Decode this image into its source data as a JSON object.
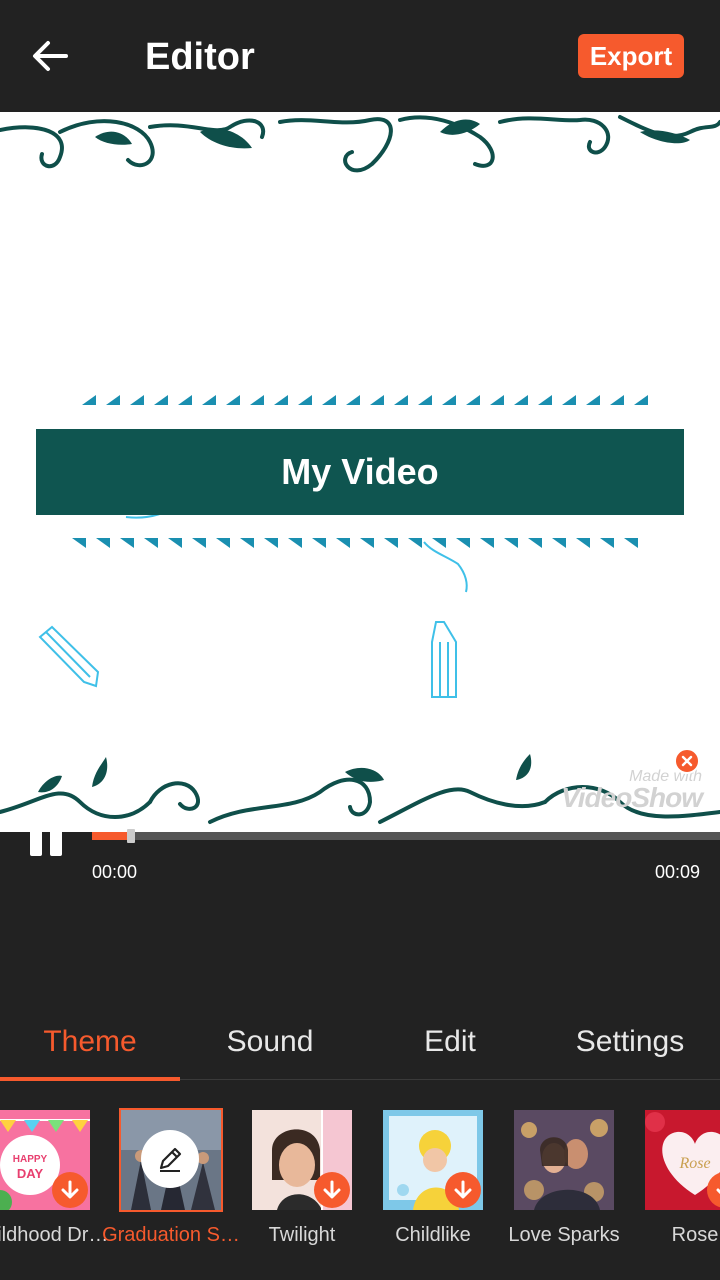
{
  "header": {
    "title": "Editor",
    "export_label": "Export"
  },
  "preview": {
    "banner_text": "My Video",
    "watermark_line1": "Made with",
    "watermark_line2": "VideoShow"
  },
  "playback": {
    "current_time": "00:00",
    "total_time": "00:09",
    "progress_fraction": 0.06
  },
  "tabs": [
    {
      "label": "Theme",
      "active": true
    },
    {
      "label": "Sound",
      "active": false
    },
    {
      "label": "Edit",
      "active": false
    },
    {
      "label": "Settings",
      "active": false
    }
  ],
  "themes": [
    {
      "label": "Childhood Dr…",
      "state": "download"
    },
    {
      "label": "Graduation S…",
      "state": "selected"
    },
    {
      "label": "Twilight",
      "state": "download"
    },
    {
      "label": "Childlike",
      "state": "download"
    },
    {
      "label": "Love Sparks",
      "state": "none"
    },
    {
      "label": "Rose",
      "state": "download"
    }
  ],
  "colors": {
    "accent": "#f65a2d",
    "background": "#222222",
    "banner": "#0f5550"
  }
}
